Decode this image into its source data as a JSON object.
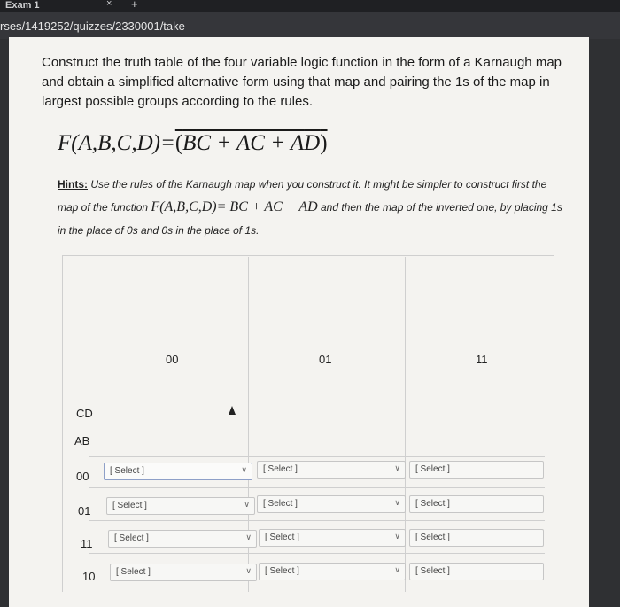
{
  "browser": {
    "tab_title": "Exam 1",
    "tab_close": "×",
    "new_tab": "+",
    "url": "rses/1419252/quizzes/2330001/take"
  },
  "question": {
    "text": "Construct the truth table of the four variable logic function in the form of a Karnaugh map and obtain a simplified alternative form using that map and pairing the 1s of the map in largest possible groups according to the rules.",
    "formula_lhs": "F(A,B,C,D)=",
    "formula_rhs_parts": [
      "B",
      "C + AC + A",
      "D"
    ]
  },
  "hints": {
    "label": "Hints:",
    "text1": "Use the rules of the Karnaugh map when you construct it. It might be simpler to construct first the map of the function",
    "formula": "F(A,B,C,D)= BC + AC + AD",
    "text2": "and then the map of the inverted one, by placing 1s in the place of 0s and 0s in the place of 1s."
  },
  "kmap": {
    "col_headers": [
      "00",
      "01",
      "11"
    ],
    "cd_label": "CD",
    "ab_label": "AB",
    "rows": [
      {
        "label": "00",
        "selects": [
          "[ Select ]",
          "[ Select ]",
          "[ Select ]"
        ]
      },
      {
        "label": "01",
        "selects": [
          "[ Select ]",
          "[ Select ]",
          "[ Select ]"
        ]
      },
      {
        "label": "11",
        "selects": [
          "[ Select ]",
          "[ Select ]",
          "[ Select ]"
        ]
      },
      {
        "label": "10",
        "selects": [
          "[ Select ]",
          "[ Select ]",
          "[ Select ]"
        ]
      }
    ]
  }
}
